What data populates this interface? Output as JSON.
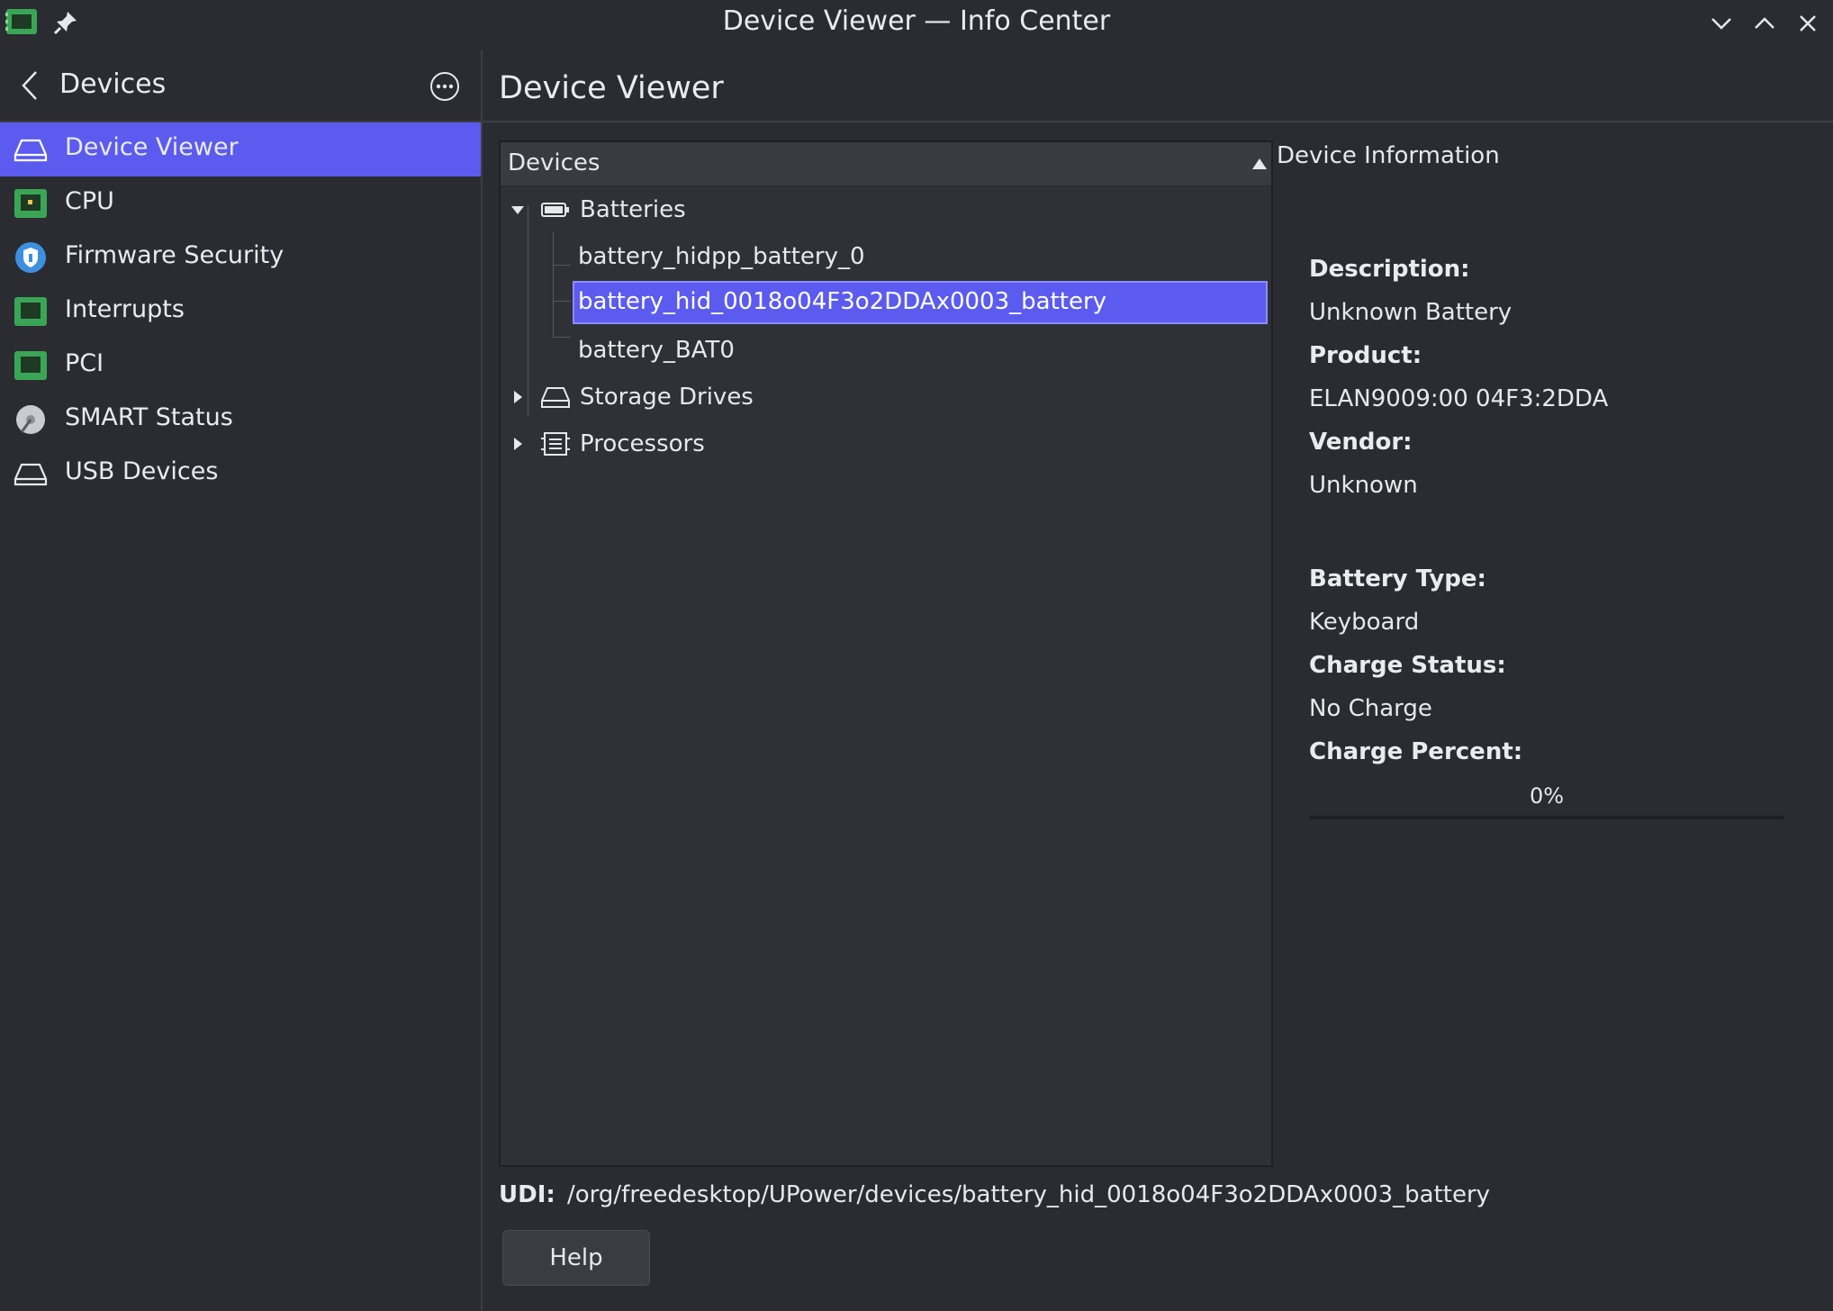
{
  "window": {
    "title": "Device Viewer — Info Center"
  },
  "sidebar": {
    "title": "Devices",
    "items": [
      {
        "label": "Device Viewer",
        "icon": "drive-icon",
        "selected": true
      },
      {
        "label": "CPU",
        "icon": "chip-icon"
      },
      {
        "label": "Firmware Security",
        "icon": "shield-icon"
      },
      {
        "label": "Interrupts",
        "icon": "chip-icon"
      },
      {
        "label": "PCI",
        "icon": "chip-icon"
      },
      {
        "label": "SMART Status",
        "icon": "disk-health-icon"
      },
      {
        "label": "USB Devices",
        "icon": "drive-icon"
      }
    ]
  },
  "main": {
    "title": "Device Viewer",
    "tree": {
      "header": "Devices",
      "rows": [
        {
          "label": "Batteries",
          "icon": "battery-icon",
          "expanded": true
        },
        {
          "label": "battery_hidpp_battery_0"
        },
        {
          "label": "battery_hid_0018o04F3o2DDAx0003_battery",
          "selected": true
        },
        {
          "label": "battery_BAT0"
        },
        {
          "label": "Storage Drives",
          "icon": "drive-icon",
          "expanded": false
        },
        {
          "label": "Processors",
          "icon": "processor-icon",
          "expanded": false
        }
      ]
    },
    "info": {
      "heading": "Device Information",
      "fields": [
        {
          "key": "Description:",
          "value": "Unknown Battery"
        },
        {
          "key": "Product:",
          "value": "ELAN9009:00 04F3:2DDA"
        },
        {
          "key": "Vendor:",
          "value": "Unknown"
        },
        {
          "key": "Battery Type:",
          "value": "Keyboard"
        },
        {
          "key": "Charge Status:",
          "value": "No Charge"
        },
        {
          "key": "Charge Percent:",
          "value": ""
        }
      ],
      "charge_percent_text": "0%",
      "charge_percent_value": 0
    },
    "udi": {
      "label": "UDI:",
      "value": "/org/freedesktop/UPower/devices/battery_hid_0018o04F3o2DDAx0003_battery"
    },
    "help_label": "Help"
  },
  "colors": {
    "accent": "#5b5bf0",
    "background": "#2a2c31",
    "panel": "#2f3136"
  }
}
